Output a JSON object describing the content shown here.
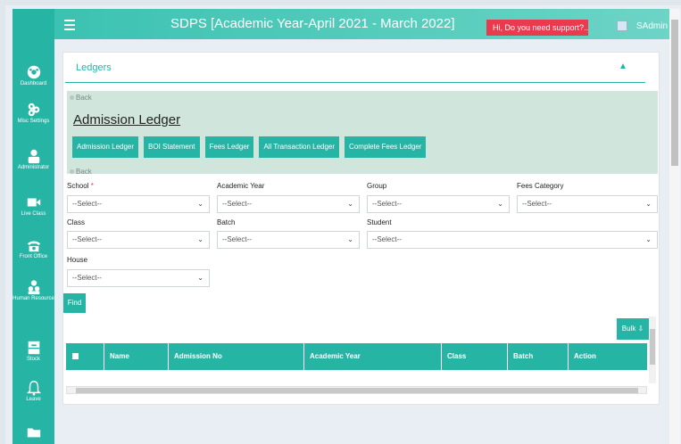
{
  "header": {
    "title": "SDPS [Academic Year-April 2021 - March 2022]",
    "support": "Hi, Do you need support?...|",
    "user": "SAdmin"
  },
  "sidebar": {
    "items": [
      {
        "label": "Dashboard",
        "icon": "dashboard-icon"
      },
      {
        "label": "Misc Settings",
        "icon": "settings-icon"
      },
      {
        "label": "Administrator",
        "icon": "user-icon"
      },
      {
        "label": "Live Class",
        "icon": "video-icon"
      },
      {
        "label": "Front Office",
        "icon": "phone-icon"
      },
      {
        "label": "Human Resource",
        "icon": "people-icon"
      },
      {
        "label": "Stock",
        "icon": "archive-icon"
      },
      {
        "label": "Leave",
        "icon": "bell-icon"
      },
      {
        "label": "",
        "icon": "folder-icon"
      }
    ]
  },
  "panel": {
    "title": "Ledgers",
    "back": "Back",
    "heading": "Admission Ledger",
    "buttons": [
      "Admission Ledger",
      "BOI Statement",
      "Fees Ledger",
      "All Transaction Ledger",
      "Complete Fees Ledger"
    ],
    "back2": "Back"
  },
  "form": {
    "school_label": "School",
    "required_mark": "*",
    "academic_year_label": "Academic Year",
    "group_label": "Group",
    "fees_category_label": "Fees Category",
    "class_label": "Class",
    "batch_label": "Batch",
    "student_label": "Student",
    "house_label": "House",
    "select_placeholder": "--Select--",
    "find": "Find",
    "bulk": "Bulk"
  },
  "table": {
    "columns": [
      "Name",
      "Admission No",
      "Academic Year",
      "Class",
      "Batch",
      "Action"
    ]
  },
  "colors": {
    "accent": "#26b5a5",
    "support": "#ea3a4d"
  }
}
